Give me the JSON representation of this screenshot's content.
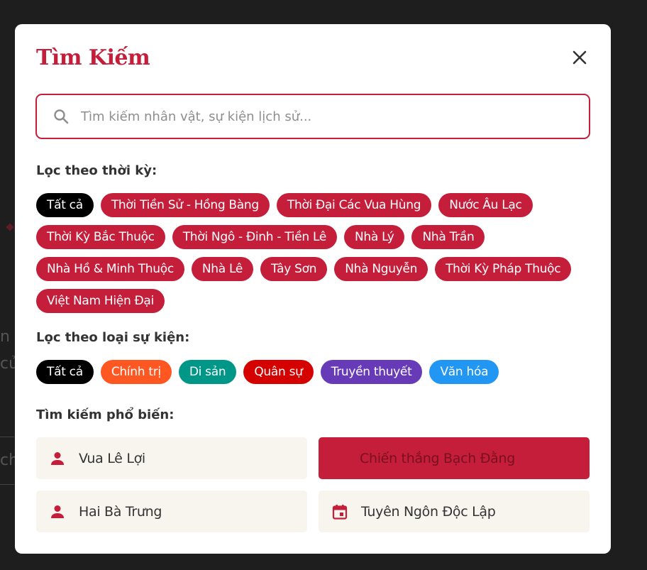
{
  "modal": {
    "title": "Tìm Kiếm",
    "close_icon": "close-icon"
  },
  "search": {
    "placeholder": "Tìm kiếm nhân vật, sự kiện lịch sử...",
    "value": "",
    "icon": "search-icon"
  },
  "period_filter": {
    "label": "Lọc theo thời kỳ:",
    "chips": [
      {
        "label": "Tất cả",
        "color": "#000000"
      },
      {
        "label": "Thời Tiền Sử - Hồng Bàng",
        "color": "#c41e3a"
      },
      {
        "label": "Thời Đại Các Vua Hùng",
        "color": "#c41e3a"
      },
      {
        "label": "Nước Âu Lạc",
        "color": "#c41e3a"
      },
      {
        "label": "Thời Kỳ Bắc Thuộc",
        "color": "#c41e3a"
      },
      {
        "label": "Thời Ngô - Đinh - Tiền Lê",
        "color": "#c41e3a"
      },
      {
        "label": "Nhà Lý",
        "color": "#c41e3a"
      },
      {
        "label": "Nhà Trần",
        "color": "#c41e3a"
      },
      {
        "label": "Nhà Hồ & Minh Thuộc",
        "color": "#c41e3a"
      },
      {
        "label": "Nhà Lê",
        "color": "#c41e3a"
      },
      {
        "label": "Tây Sơn",
        "color": "#c41e3a"
      },
      {
        "label": "Nhà Nguyễn",
        "color": "#c41e3a"
      },
      {
        "label": "Thời Kỳ Pháp Thuộc",
        "color": "#c41e3a"
      },
      {
        "label": "Việt Nam Hiện Đại",
        "color": "#c41e3a"
      }
    ]
  },
  "event_filter": {
    "label": "Lọc theo loại sự kiện:",
    "chips": [
      {
        "label": "Tất cả",
        "color": "#000000"
      },
      {
        "label": "Chính trị",
        "color": "#ff5722"
      },
      {
        "label": "Di sản",
        "color": "#009688"
      },
      {
        "label": "Quân sự",
        "color": "#d50000"
      },
      {
        "label": "Truyền thuyết",
        "color": "#673ab7"
      },
      {
        "label": "Văn hóa",
        "color": "#2196f3"
      }
    ]
  },
  "popular": {
    "label": "Tìm kiếm phổ biến:",
    "items": [
      {
        "label": "Vua Lê Lợi",
        "icon": "person-icon"
      },
      {
        "label": "Chiến thắng Bạch Đằng",
        "icon": "none"
      },
      {
        "label": "Hai Bà Trưng",
        "icon": "person-icon"
      },
      {
        "label": "Tuyên Ngôn Độc Lập",
        "icon": "calendar-icon"
      }
    ]
  },
  "background": {
    "fragments": [
      "n",
      "củ",
      "ch"
    ]
  },
  "colors": {
    "accent": "#c41e3a",
    "popular_bg": "#f8f5ee"
  }
}
